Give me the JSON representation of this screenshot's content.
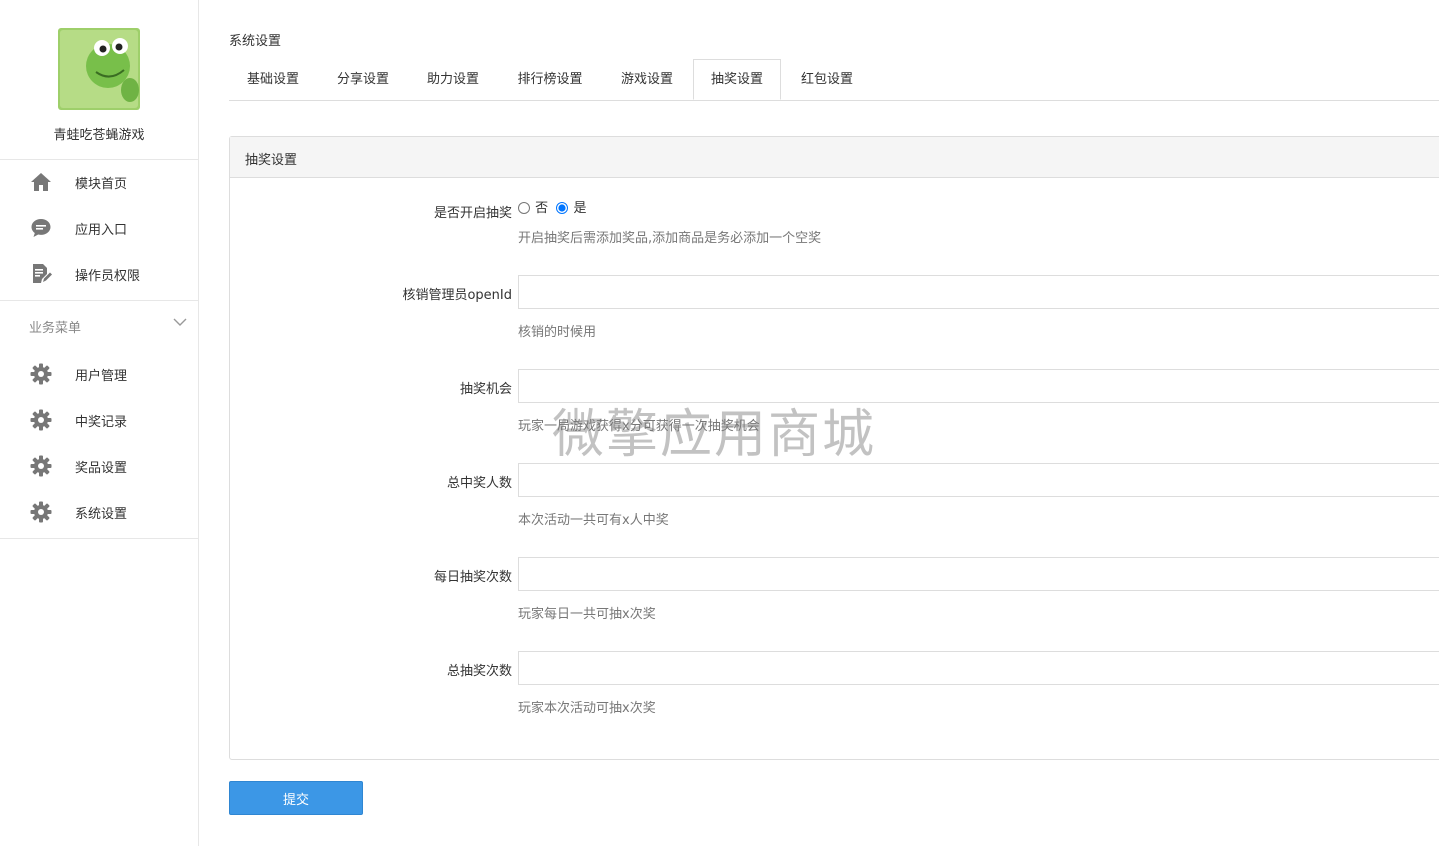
{
  "sidebar": {
    "app_name": "青蛙吃苍蝇游戏",
    "logo_text": "青蛙吃苍蝇",
    "nav_items": [
      {
        "label": "模块首页",
        "icon": "home-icon"
      },
      {
        "label": "应用入口",
        "icon": "chat-bubble-icon"
      },
      {
        "label": "操作员权限",
        "icon": "edit-document-icon"
      }
    ],
    "section_title": "业务菜单",
    "business_items": [
      {
        "label": "用户管理",
        "icon": "gear-icon"
      },
      {
        "label": "中奖记录",
        "icon": "gear-icon"
      },
      {
        "label": "奖品设置",
        "icon": "gear-icon"
      },
      {
        "label": "系统设置",
        "icon": "gear-icon"
      }
    ]
  },
  "breadcrumb": "系统设置",
  "tabs": [
    {
      "label": "基础设置",
      "active": false
    },
    {
      "label": "分享设置",
      "active": false
    },
    {
      "label": "助力设置",
      "active": false
    },
    {
      "label": "排行榜设置",
      "active": false
    },
    {
      "label": "游戏设置",
      "active": false
    },
    {
      "label": "抽奖设置",
      "active": true
    },
    {
      "label": "红包设置",
      "active": false
    }
  ],
  "panel": {
    "title": "抽奖设置",
    "enable_lottery": {
      "label": "是否开启抽奖",
      "options": [
        "否",
        "是"
      ],
      "selected": "是",
      "help": "开启抽奖后需添加奖品,添加商品是务必添加一个空奖"
    },
    "admin_openid": {
      "label": "核销管理员openId",
      "value": "",
      "help": "核销的时候用"
    },
    "lottery_chance": {
      "label": "抽奖机会",
      "value": "",
      "help": "玩家一局游戏获得x分可获得一次抽奖机会"
    },
    "total_winners": {
      "label": "总中奖人数",
      "value": "",
      "help": "本次活动一共可有x人中奖"
    },
    "daily_draws": {
      "label": "每日抽奖次数",
      "value": "",
      "help": "玩家每日一共可抽x次奖"
    },
    "total_draws": {
      "label": "总抽奖次数",
      "value": "",
      "help": "玩家本次活动可抽x次奖"
    }
  },
  "submit_label": "提交",
  "watermark": "微擎应用商城",
  "colors": {
    "primary": "#3c97e6",
    "border": "#dddddd",
    "panel_head": "#f5f5f5"
  }
}
